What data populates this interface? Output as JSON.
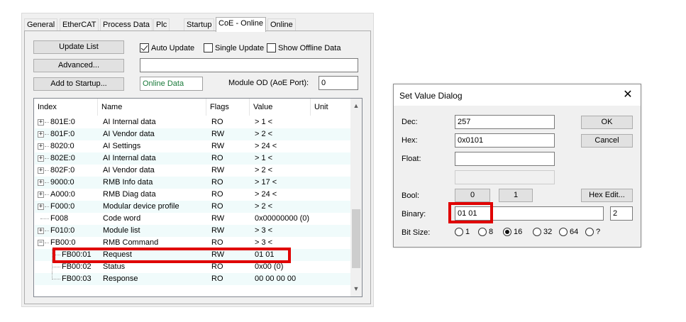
{
  "tabs": [
    "General",
    "EtherCAT",
    "Process Data",
    "Plc",
    "Startup",
    "CoE - Online",
    "Online"
  ],
  "buttons": {
    "update_list": "Update List",
    "advanced": "Advanced...",
    "add_to_startup": "Add to Startup..."
  },
  "checkboxes": {
    "auto_update": "Auto Update",
    "single_update": "Single Update",
    "show_offline": "Show Offline Data"
  },
  "top_input_value": "",
  "data_source": "Online Data",
  "module_od_label": "Module OD (AoE Port):",
  "module_od_value": "0",
  "columns": [
    "Index",
    "Name",
    "Flags",
    "Value",
    "Unit"
  ],
  "rows": [
    {
      "index": "801E:0",
      "name": "AI Internal data",
      "flags": "RO",
      "value": "> 1 <",
      "exp": "+"
    },
    {
      "index": "801F:0",
      "name": "AI Vendor data",
      "flags": "RW",
      "value": "> 2 <",
      "exp": "+"
    },
    {
      "index": "8020:0",
      "name": "AI Settings",
      "flags": "RW",
      "value": "> 24 <",
      "exp": "+"
    },
    {
      "index": "802E:0",
      "name": "AI Internal data",
      "flags": "RO",
      "value": "> 1 <",
      "exp": "+"
    },
    {
      "index": "802F:0",
      "name": "AI Vendor data",
      "flags": "RW",
      "value": "> 2 <",
      "exp": "+"
    },
    {
      "index": "9000:0",
      "name": "RMB Info data",
      "flags": "RO",
      "value": "> 17 <",
      "exp": "+"
    },
    {
      "index": "A000:0",
      "name": "RMB Diag data",
      "flags": "RO",
      "value": "> 24 <",
      "exp": "+"
    },
    {
      "index": "F000:0",
      "name": "Modular device profile",
      "flags": "RO",
      "value": "> 2 <",
      "exp": "+"
    },
    {
      "index": "F008",
      "name": "Code word",
      "flags": "RW",
      "value": "0x00000000 (0)",
      "exp": ""
    },
    {
      "index": "F010:0",
      "name": "Module list",
      "flags": "RW",
      "value": "> 3 <",
      "exp": "+"
    },
    {
      "index": "FB00:0",
      "name": "RMB Command",
      "flags": "RO",
      "value": "> 3 <",
      "exp": "-"
    },
    {
      "index": "FB00:01",
      "name": "Request",
      "flags": "RW",
      "value": "01 01",
      "exp": "child"
    },
    {
      "index": "FB00:02",
      "name": "Status",
      "flags": "RO",
      "value": "0x00 (0)",
      "exp": "child"
    },
    {
      "index": "FB00:03",
      "name": "Response",
      "flags": "RO",
      "value": "00 00 00 00",
      "exp": "child"
    }
  ],
  "dialog": {
    "title": "Set Value Dialog",
    "dec_label": "Dec:",
    "dec_value": "257",
    "hex_label": "Hex:",
    "hex_value": "0x0101",
    "float_label": "Float:",
    "float_value": "",
    "bool_label": "Bool:",
    "bool_0": "0",
    "bool_1": "1",
    "hex_edit": "Hex Edit...",
    "binary_label": "Binary:",
    "binary_value": "01 01",
    "binary_count": "2",
    "bitsize_label": "Bit Size:",
    "bitsizes": [
      "1",
      "8",
      "16",
      "32",
      "64",
      "?"
    ],
    "bitsize_selected": "16",
    "ok": "OK",
    "cancel": "Cancel"
  },
  "colors": {
    "highlight": "#e00000",
    "alt_row": "#f0fbfb"
  }
}
